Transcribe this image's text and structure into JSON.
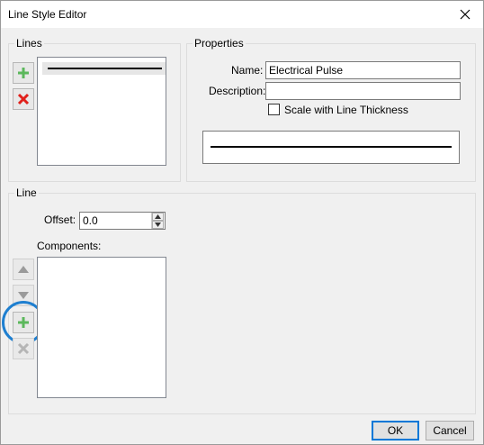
{
  "window": {
    "title": "Line Style Editor"
  },
  "lines_group": {
    "label": "Lines"
  },
  "properties_group": {
    "label": "Properties",
    "name_label": "Name:",
    "name_value": "Electrical Pulse",
    "description_label": "Description:",
    "description_value": "",
    "scale_label": "Scale with Line Thickness",
    "scale_checked": false
  },
  "line_group": {
    "label": "Line",
    "offset_label": "Offset:",
    "offset_value": "0.0",
    "components_label": "Components:"
  },
  "buttons": {
    "ok": "OK",
    "cancel": "Cancel"
  },
  "icons": {
    "add": "plus-icon",
    "delete": "delete-x-icon",
    "move_up": "arrow-up-icon",
    "move_down": "arrow-down-icon",
    "close": "close-icon"
  },
  "colors": {
    "add_green": "#5cb85c",
    "delete_red": "#e0201b",
    "highlight_blue": "#1e7fd0"
  }
}
